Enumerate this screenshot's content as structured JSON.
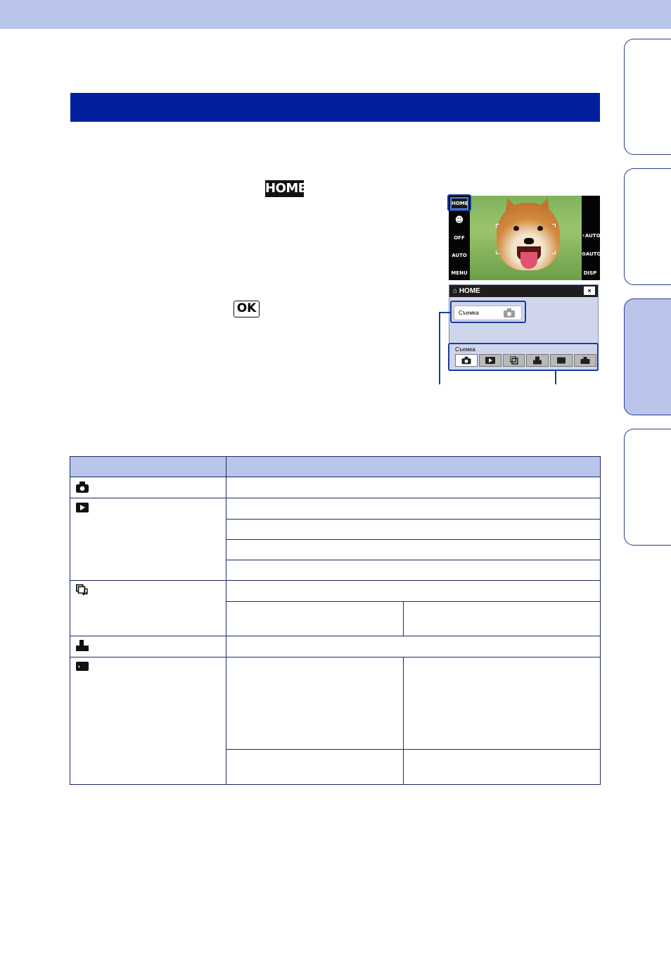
{
  "page": {
    "header_band_color": "#b9c5ea",
    "section_bar_color": "#0020a0",
    "accent_outline_color": "#1a3d9e"
  },
  "side_tabs": [
    {
      "name": "tab-1",
      "active": false
    },
    {
      "name": "tab-2",
      "active": false
    },
    {
      "name": "tab-3",
      "active": true
    },
    {
      "name": "tab-4",
      "active": false
    }
  ],
  "inline_glyphs": {
    "home_button": "HOME",
    "ok_button": "OK"
  },
  "camera_screen": {
    "home_button_label": "HOME",
    "menu_label": "MENU",
    "disp_label": "DISP",
    "flash_label": "AUTO",
    "iso_label": "AUTO",
    "macro_label": "AUTO",
    "timer_label": "OFF"
  },
  "home_menu": {
    "title": "HOME",
    "close_icon": "×",
    "selected_item": "Съемка",
    "category_label": "Съемка",
    "categories": [
      "camera-icon",
      "playback-icon",
      "slideshow-icon",
      "print-icon",
      "memory-icon",
      "settings-icon"
    ]
  },
  "table": {
    "row_icons": [
      "camera-icon",
      "playback-icon",
      "slideshow-music-icon",
      "print-icon",
      "memory-card-icon"
    ]
  }
}
